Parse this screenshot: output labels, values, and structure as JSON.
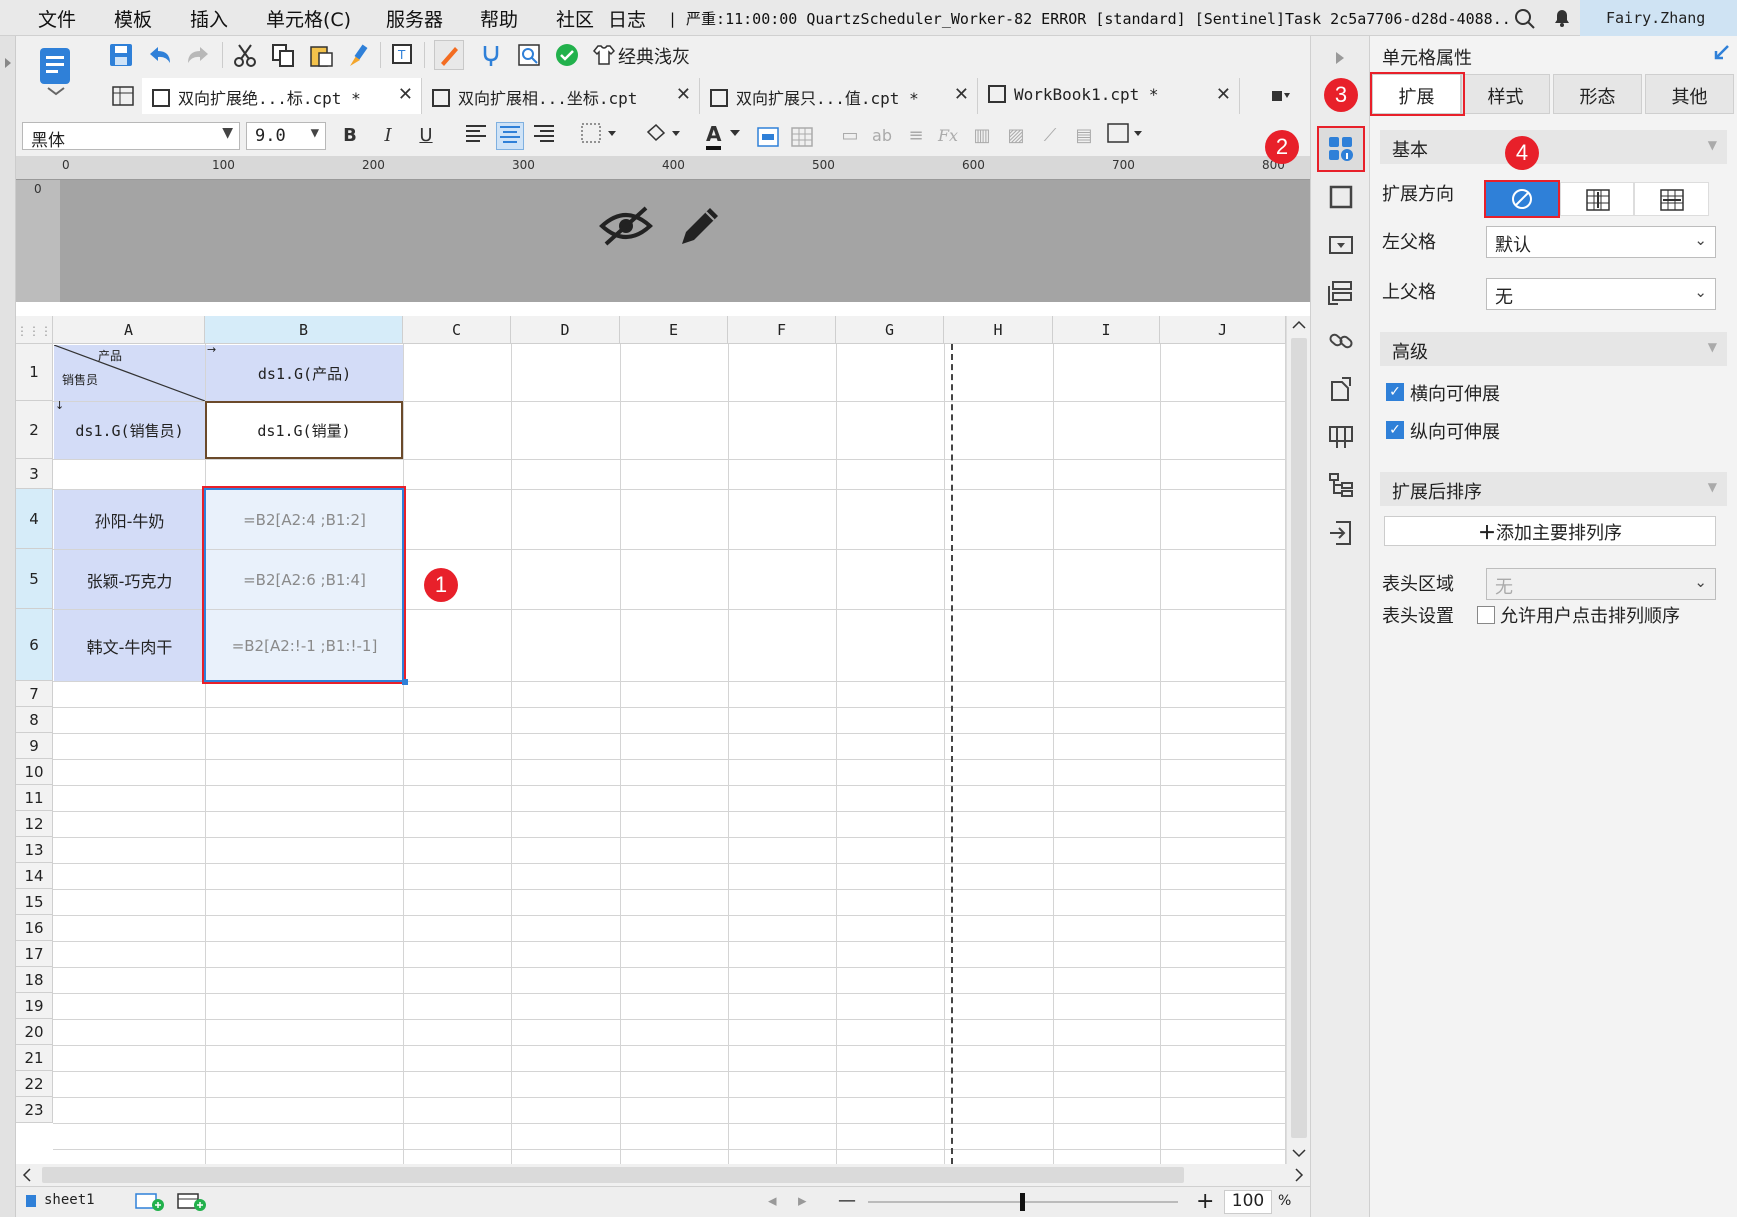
{
  "menu": {
    "items": [
      "文件",
      "模板",
      "插入",
      "单元格(C)",
      "服务器",
      "帮助",
      "社区",
      "日志"
    ],
    "log_text": "| 严重:11:00:00 QuartzScheduler_Worker-82 ERROR [standard] [Sentinel]Task 2c5a7706-d28d-4088...",
    "user": "Fairy.Zhang"
  },
  "toolbar": {
    "theme_label": "经典浅灰"
  },
  "tabs": [
    {
      "label": "双向扩展绝...标.cpt *"
    },
    {
      "label": "双向扩展相...坐标.cpt"
    },
    {
      "label": "双向扩展只...值.cpt *"
    },
    {
      "label": "WorkBook1.cpt *"
    }
  ],
  "format": {
    "font_name": "黑体",
    "font_size": "9.0",
    "bold": "B",
    "italic": "I",
    "underline": "U",
    "font_color_glyph": "A"
  },
  "ruler": {
    "ticks": [
      "0",
      "100",
      "200",
      "300",
      "400",
      "500",
      "600",
      "700",
      "800"
    ],
    "vertical_zero": "0"
  },
  "grid": {
    "columns": [
      "A",
      "B",
      "C",
      "D",
      "E",
      "F",
      "G",
      "H",
      "I",
      "J"
    ],
    "rows": [
      "1",
      "2",
      "3",
      "4",
      "5",
      "6",
      "7",
      "8",
      "9",
      "10",
      "11",
      "12",
      "13",
      "14",
      "15",
      "16",
      "17",
      "18",
      "19",
      "20",
      "21",
      "22",
      "23"
    ],
    "a1_top": "产品",
    "a1_bottom": "销售员",
    "b1": "ds1.G(产品)",
    "a2": "ds1.G(销售员)",
    "b2": "ds1.G(销量)",
    "a4": "孙阳-牛奶",
    "a5": "张颖-巧克力",
    "a6": "韩文-牛肉干",
    "b4": "=B2[A2:4 ;B1:2]",
    "b5": "=B2[A2:6 ;B1:4]",
    "b6": "=B2[A2:!-1 ;B1:!-1]"
  },
  "status": {
    "sheet": "sheet1",
    "zoom": "100",
    "percent": "%",
    "minus": "—",
    "plus": "+"
  },
  "panel": {
    "title": "单元格属性",
    "tabs": [
      "扩展",
      "样式",
      "形态",
      "其他"
    ],
    "basic_header": "基本",
    "expand_direction_label": "扩展方向",
    "left_parent_label": "左父格",
    "left_parent_value": "默认",
    "top_parent_label": "上父格",
    "top_parent_value": "无",
    "advanced_header": "高级",
    "h_stretch_label": "横向可伸展",
    "v_stretch_label": "纵向可伸展",
    "check_glyph": "✓",
    "sort_header": "扩展后排序",
    "add_sort_label": "添加主要排列序",
    "add_sort_plus": "＋",
    "header_area_label": "表头区域",
    "header_area_value": "无",
    "header_setting_label": "表头设置",
    "allow_click_sort_label": "允许用户点击排列顺序"
  },
  "markers": [
    "1",
    "2",
    "3",
    "4"
  ],
  "colors": {
    "accent": "#2f80d8",
    "marker_red": "#e8202a",
    "selected_cell_fill": "#d3dcf7"
  }
}
